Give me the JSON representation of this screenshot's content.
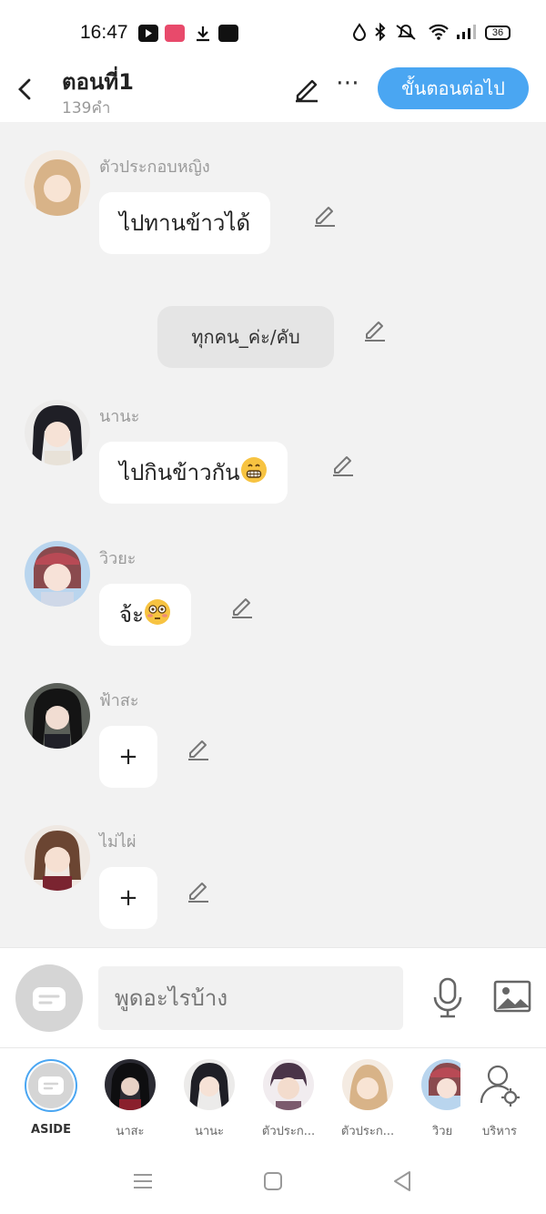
{
  "status_bar": {
    "time": "16:47",
    "battery": "36",
    "apps": [
      "youtube-icon",
      "manga-toon-icon",
      "download-icon",
      "webtoon-icon"
    ],
    "right_icons": [
      "data-saver-icon",
      "bluetooth-icon",
      "silent-icon",
      "wifi-icon",
      "signal-icon",
      "battery-icon"
    ]
  },
  "header": {
    "title": "ตอนที่1",
    "subtitle": "139คำ",
    "next_button": "ขั้นตอนต่อไป",
    "more": "⋯"
  },
  "messages": [
    {
      "speaker": "ตัวประกอบหญิง",
      "text": "ไปทานข้าวได้",
      "emoji": "",
      "avatar_color": "#e7c8a8"
    },
    {
      "narration": "ทุกคน_ค่ะ/คับ"
    },
    {
      "speaker": "นานะ",
      "text": "ไปกินข้าวกัน",
      "emoji": "grinning",
      "avatar_color": "#3a3a44"
    },
    {
      "speaker": "วิวยะ",
      "text": "จ้ะ",
      "emoji": "flushed",
      "avatar_color": "#a9c8e6"
    },
    {
      "speaker": "ฟ้าสะ",
      "text": "+",
      "emoji": "",
      "avatar_color": "#2a2a2a"
    },
    {
      "speaker": "ไม่ไผ่",
      "text": "+",
      "emoji": "",
      "avatar_color": "#c9a48a"
    }
  ],
  "input": {
    "placeholder": "พูดอะไรบ้าง"
  },
  "characters": [
    {
      "label": "ASIDE"
    },
    {
      "label": "นาสะ",
      "color": "#2b2b33"
    },
    {
      "label": "นานะ",
      "color": "#3a3a44"
    },
    {
      "label": "ตัวประก...",
      "color": "#7b5a6d"
    },
    {
      "label": "ตัวประก...",
      "color": "#e7c8a8"
    },
    {
      "label": "วิวย",
      "color": "#a9c8e6"
    },
    {
      "label": "บริหาร"
    }
  ],
  "colors": {
    "accent": "#4aa6f2",
    "chat_bg": "#f2f2f2",
    "narration_bg": "#e5e5e5"
  }
}
